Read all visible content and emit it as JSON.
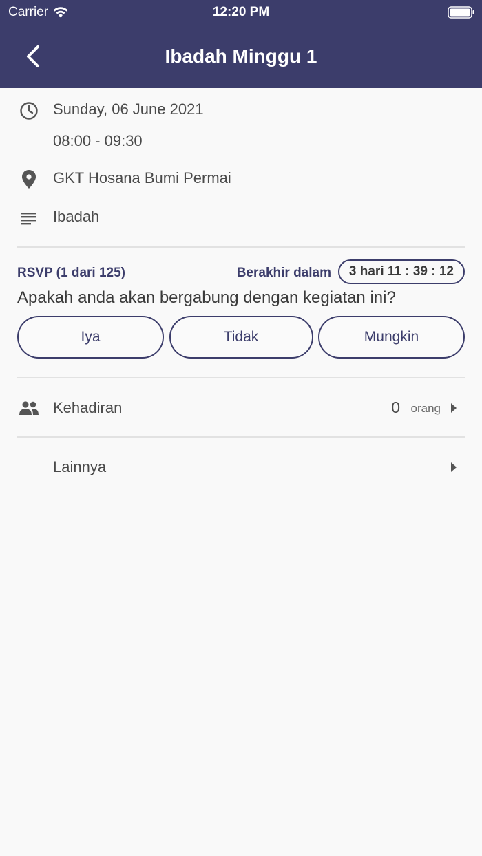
{
  "status_bar": {
    "carrier": "Carrier",
    "time": "12:20 PM"
  },
  "nav": {
    "title": "Ibadah Minggu 1"
  },
  "event": {
    "date": "Sunday, 06 June 2021",
    "time_range": "08:00 - 09:30",
    "location": "GKT Hosana Bumi Permai",
    "category": "Ibadah"
  },
  "rsvp": {
    "label": "RSVP (1 dari 125)",
    "ends_label": "Berakhir dalam",
    "countdown": "3 hari 11 : 39 : 12",
    "question": "Apakah anda akan bergabung dengan kegiatan ini?",
    "options": [
      "Iya",
      "Tidak",
      "Mungkin"
    ]
  },
  "attendance": {
    "label": "Kehadiran",
    "count": "0",
    "unit": "orang"
  },
  "others": {
    "label": "Lainnya"
  },
  "colors": {
    "primary": "#3c3d6b",
    "background": "#f9f9f9",
    "divider": "#e2e2e2"
  }
}
